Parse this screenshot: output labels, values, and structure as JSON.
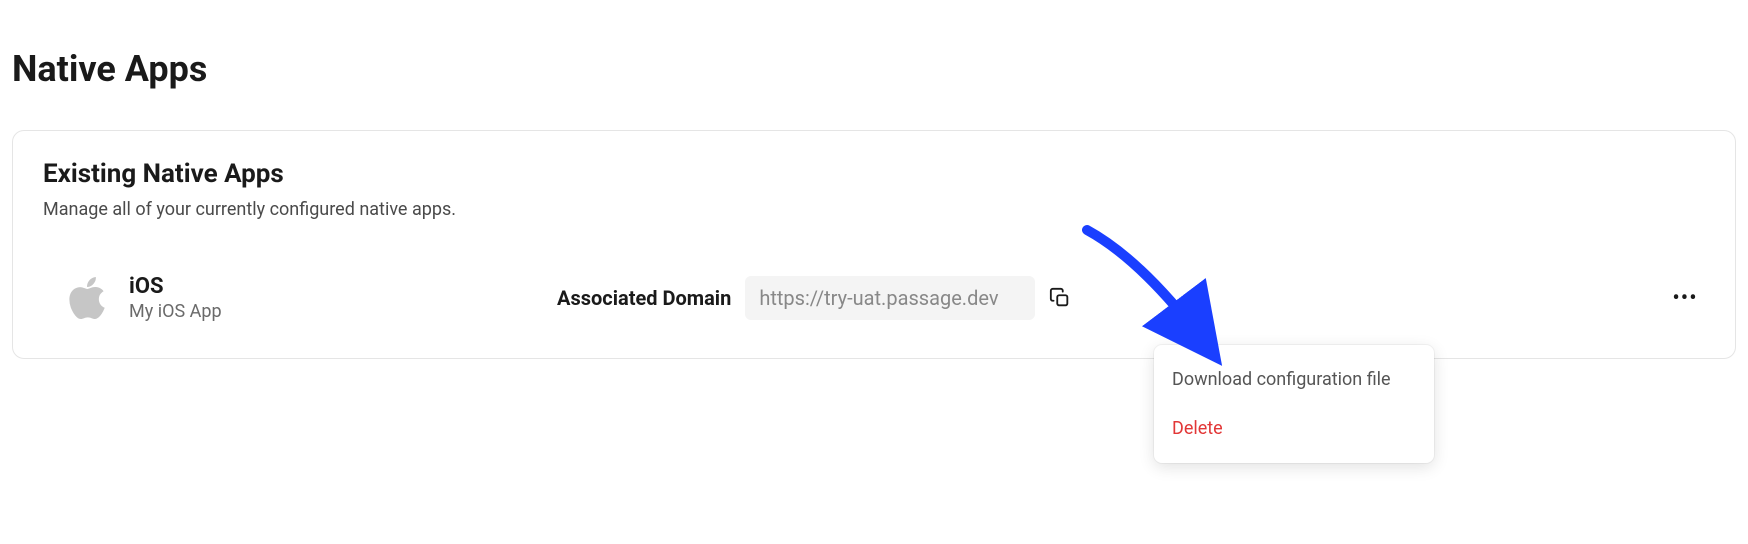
{
  "page": {
    "title": "Native Apps"
  },
  "card": {
    "title": "Existing Native Apps",
    "subtitle": "Manage all of your currently configured native apps."
  },
  "app": {
    "platform": "iOS",
    "name": "My iOS App",
    "domain_label": "Associated Domain",
    "domain_value": "https://try-uat.passage.dev"
  },
  "menu": {
    "download": "Download configuration file",
    "delete": "Delete"
  }
}
